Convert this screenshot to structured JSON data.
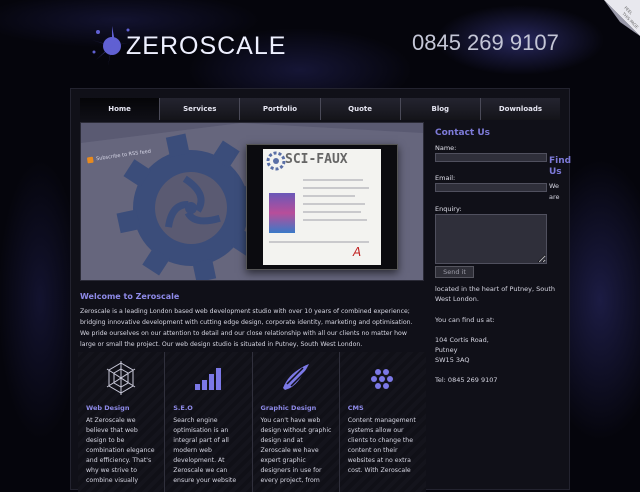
{
  "header": {
    "logo_text": "ZEROSCALE",
    "phone": "0845 269 9107",
    "peel_line1": "PEEL",
    "peel_line2": "THIS PAGE"
  },
  "nav": {
    "items": [
      "Home",
      "Services",
      "Portfolio",
      "Quote",
      "Blog",
      "Downloads"
    ],
    "active": "Home"
  },
  "hero": {
    "subscribe_text": "Subscribe to RSS feed",
    "screen_title": "SCI-FAUX"
  },
  "welcome": {
    "title": "Welcome to Zeroscale",
    "text": "Zeroscale is a leading London based web development studio with over 10 years of combined experience; bridging innovative development with cutting edge design, corporate identity, marketing and optimisation. We pride ourselves on our attention to detail and our close relationship with all our clients no matter how large or small the project. Our web design studio is situated in Putney, South West London."
  },
  "services": [
    {
      "title": "Web Design",
      "icon": "web-icon",
      "text": "At Zeroscale we believe that web design to be combination elegance and efficiency. That's why we strive to combine visually"
    },
    {
      "title": "S.E.O",
      "icon": "seo-bars-icon",
      "text": "Search engine optimisation is an integral part of all modern web development. At Zeroscale we can ensure your website"
    },
    {
      "title": "Graphic Design",
      "icon": "brush-icon",
      "text": "You can't have web design without graphic design and at Zeroscale we have expert graphic designers in use for every project, from"
    },
    {
      "title": "CMS",
      "icon": "cms-dots-icon",
      "text": "Content management systems allow our clients to change the content on their websites at no extra cost. With Zeroscale"
    }
  ],
  "contact": {
    "title": "Contact Us",
    "name_label": "Name:",
    "email_label": "Email:",
    "enquiry_label": "Enquiry:",
    "send_label": "Send it",
    "find_us": "Find Us",
    "frag_we": "We",
    "frag_are": "are",
    "location": "located in the heart of Putney, South West London.",
    "find_text": "You can find us at:",
    "address1": "104 Cortis Road,",
    "address2": "Putney",
    "address3": "SW15 3AQ",
    "tel": "Tel: 0845 269 9107"
  }
}
